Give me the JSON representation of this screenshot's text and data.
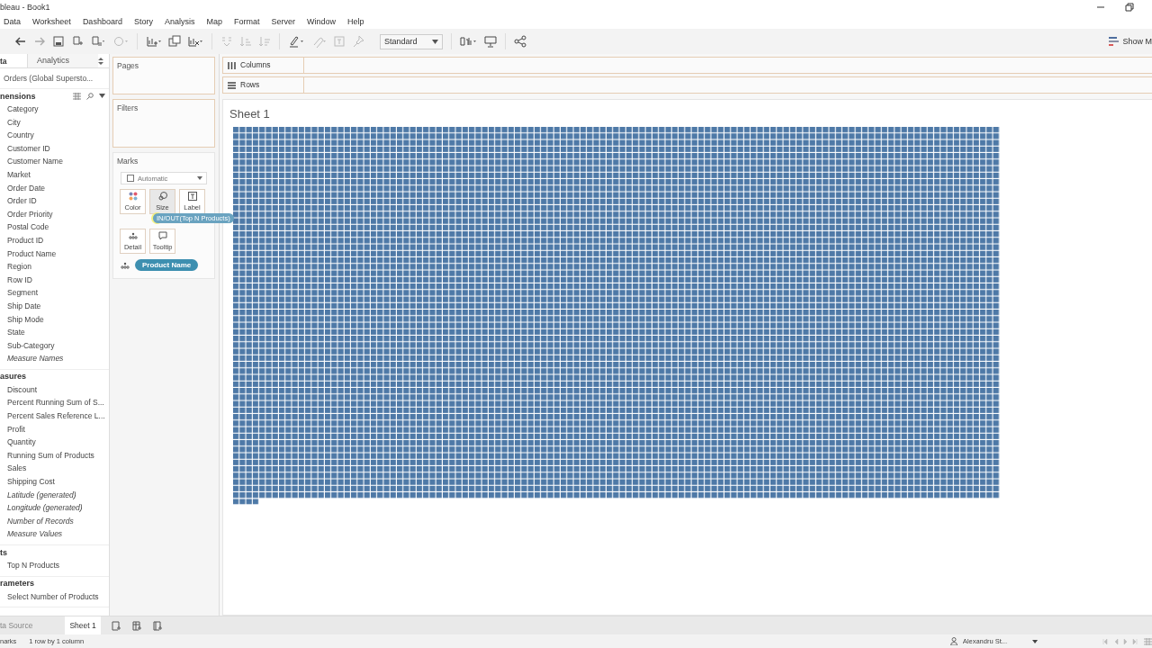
{
  "window": {
    "title": "bleau - Book1"
  },
  "menu": [
    "Data",
    "Worksheet",
    "Dashboard",
    "Story",
    "Analysis",
    "Map",
    "Format",
    "Server",
    "Window",
    "Help"
  ],
  "toolbar": {
    "fit": "Standard",
    "show_me": "Show M"
  },
  "data_pane": {
    "tabs": [
      {
        "label": "ta",
        "selected": true
      },
      {
        "label": "Analytics",
        "selected": false
      }
    ],
    "source": "Orders (Global Supersto...",
    "sections": [
      {
        "title": "nensions",
        "tools": true,
        "fields": [
          {
            "name": "Category",
            "italic": false
          },
          {
            "name": "City",
            "italic": false
          },
          {
            "name": "Country",
            "italic": false
          },
          {
            "name": "Customer ID",
            "italic": false
          },
          {
            "name": "Customer Name",
            "italic": false
          },
          {
            "name": "Market",
            "italic": false
          },
          {
            "name": "Order Date",
            "italic": false
          },
          {
            "name": "Order ID",
            "italic": false
          },
          {
            "name": "Order Priority",
            "italic": false
          },
          {
            "name": "Postal Code",
            "italic": false
          },
          {
            "name": "Product ID",
            "italic": false
          },
          {
            "name": "Product Name",
            "italic": false
          },
          {
            "name": "Region",
            "italic": false
          },
          {
            "name": "Row ID",
            "italic": false
          },
          {
            "name": "Segment",
            "italic": false
          },
          {
            "name": "Ship Date",
            "italic": false
          },
          {
            "name": "Ship Mode",
            "italic": false
          },
          {
            "name": "State",
            "italic": false
          },
          {
            "name": "Sub-Category",
            "italic": false
          },
          {
            "name": "Measure Names",
            "italic": true
          }
        ]
      },
      {
        "title": "asures",
        "tools": false,
        "fields": [
          {
            "name": "Discount",
            "italic": false
          },
          {
            "name": "Percent Running Sum of S...",
            "italic": false
          },
          {
            "name": "Percent Sales Reference L...",
            "italic": false
          },
          {
            "name": "Profit",
            "italic": false
          },
          {
            "name": "Quantity",
            "italic": false
          },
          {
            "name": "Running Sum of Products",
            "italic": false
          },
          {
            "name": "Sales",
            "italic": false
          },
          {
            "name": "Shipping Cost",
            "italic": false
          },
          {
            "name": "Latitude (generated)",
            "italic": true
          },
          {
            "name": "Longitude (generated)",
            "italic": true
          },
          {
            "name": "Number of Records",
            "italic": true
          },
          {
            "name": "Measure Values",
            "italic": true
          }
        ]
      },
      {
        "title": "ts",
        "tools": false,
        "fields": [
          {
            "name": "Top N Products",
            "italic": false
          }
        ]
      },
      {
        "title": "rameters",
        "tools": false,
        "fields": [
          {
            "name": "Select Number of Products",
            "italic": false
          }
        ]
      }
    ]
  },
  "cards": {
    "pages": "Pages",
    "filters": "Filters",
    "columns": "Columns",
    "rows": "Rows"
  },
  "marks": {
    "title": "Marks",
    "type": "Automatic",
    "buttons": [
      {
        "label": "Color",
        "kind": "color"
      },
      {
        "label": "Size",
        "kind": "size"
      },
      {
        "label": "Label",
        "kind": "label"
      },
      {
        "label": "Detail",
        "kind": "detail"
      },
      {
        "label": "Tooltip",
        "kind": "tooltip"
      }
    ],
    "pill": "Product Name"
  },
  "drag_pill": "IN/OUT(Top N Products)",
  "sheet": {
    "title": "Sheet 1"
  },
  "sheet_tabs": [
    {
      "label": "ta Source",
      "selected": false
    },
    {
      "label": "Sheet 1",
      "selected": true
    }
  ],
  "status": {
    "marks": "narks",
    "size": "1 row by 1 column",
    "user": "Alexandru St..."
  }
}
